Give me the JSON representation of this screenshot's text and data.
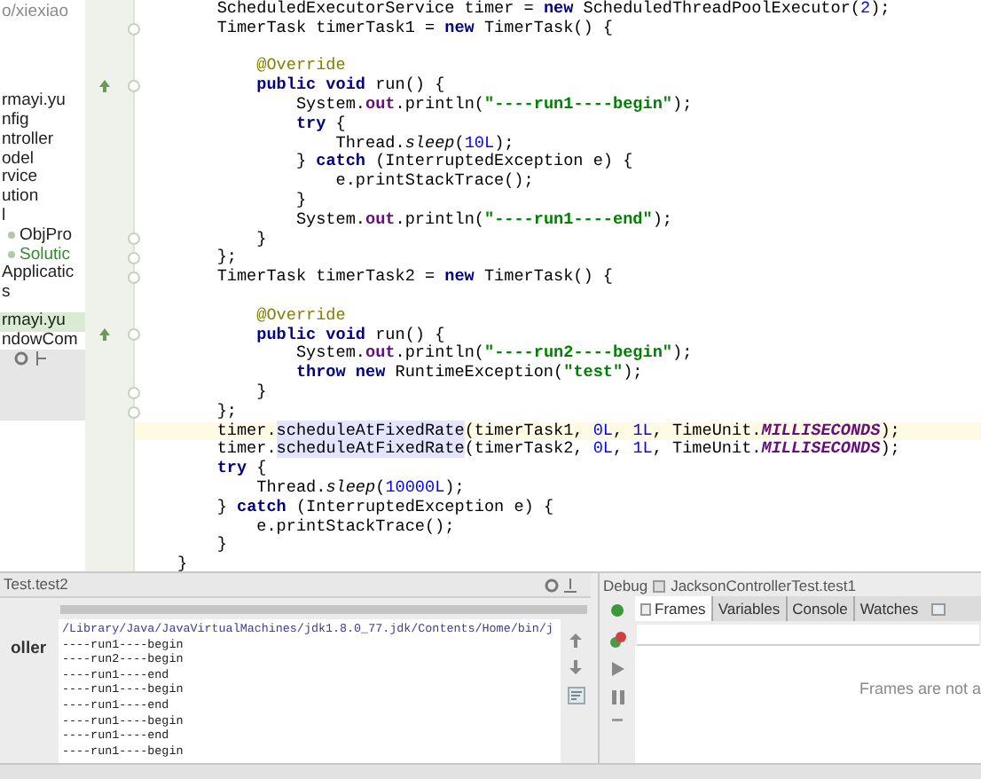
{
  "project_panel": {
    "path": "o/xiexiao",
    "items": [
      {
        "label": "rmayi.yu",
        "kind": "plain",
        "color": "#1f1f1f",
        "selected": false
      },
      {
        "label": "nfig",
        "kind": "plain",
        "color": "#1f1f1f",
        "selected": false
      },
      {
        "label": "ntroller",
        "kind": "plain",
        "color": "#1f1f1f",
        "selected": false
      },
      {
        "label": "odel",
        "kind": "plain",
        "color": "#1f1f1f",
        "selected": false
      },
      {
        "label": "rvice",
        "kind": "plain",
        "color": "#1f1f1f",
        "selected": false
      },
      {
        "label": "ution",
        "kind": "plain",
        "color": "#1f1f1f",
        "selected": false
      },
      {
        "label": "l",
        "kind": "plain",
        "color": "#1f1f1f",
        "selected": false
      },
      {
        "label": "ObjPro",
        "kind": "class",
        "color": "#1f1f1f",
        "selected": false
      },
      {
        "label": "Solutic",
        "kind": "class",
        "color": "#2e8b2e",
        "selected": false
      },
      {
        "label": "Applicatic",
        "kind": "plain",
        "color": "#1f1f1f",
        "selected": false
      },
      {
        "label": "s",
        "kind": "plain",
        "color": "#1f1f1f",
        "selected": false
      },
      {
        "label": "rmayi.yu",
        "kind": "plain",
        "color": "#1f1f1f",
        "selected": true
      },
      {
        "label": "ndowCom",
        "kind": "plain",
        "color": "#1f1f1f",
        "selected": false
      }
    ]
  },
  "editor": {
    "lines": [
      {
        "kind": "code",
        "fold": false,
        "override": false,
        "current": false,
        "tokens": [
          {
            "kind": "plain",
            "text": "    ScheduledExecutorService timer = "
          },
          {
            "kind": "keyword",
            "text": "new"
          },
          {
            "kind": "plain",
            "text": " ScheduledThreadPoolExecutor("
          },
          {
            "kind": "number",
            "text": "2"
          },
          {
            "kind": "plain",
            "text": ");"
          }
        ]
      },
      {
        "kind": "code",
        "fold": true,
        "override": false,
        "current": false,
        "tokens": [
          {
            "kind": "plain",
            "text": "    TimerTask timerTask1 = "
          },
          {
            "kind": "keyword",
            "text": "new"
          },
          {
            "kind": "plain",
            "text": " TimerTask() {"
          }
        ]
      },
      {
        "kind": "blank"
      },
      {
        "kind": "code",
        "fold": false,
        "override": false,
        "current": false,
        "tokens": [
          {
            "kind": "annotation",
            "text": "        @Override"
          }
        ]
      },
      {
        "kind": "code",
        "fold": true,
        "override": true,
        "current": false,
        "tokens": [
          {
            "kind": "keyword",
            "text": "        public void"
          },
          {
            "kind": "plain",
            "text": " run() {"
          }
        ]
      },
      {
        "kind": "code",
        "fold": false,
        "override": false,
        "current": false,
        "tokens": [
          {
            "kind": "plain",
            "text": "            System."
          },
          {
            "kind": "field",
            "text": "out"
          },
          {
            "kind": "plain",
            "text": ".println("
          },
          {
            "kind": "string",
            "text": "\"----run1----begin\""
          },
          {
            "kind": "plain",
            "text": ");"
          }
        ]
      },
      {
        "kind": "code",
        "fold": false,
        "override": false,
        "current": false,
        "tokens": [
          {
            "kind": "keyword",
            "text": "            try"
          },
          {
            "kind": "plain",
            "text": " {"
          }
        ]
      },
      {
        "kind": "code",
        "fold": false,
        "override": false,
        "current": false,
        "tokens": [
          {
            "kind": "plain",
            "text": "                Thread."
          },
          {
            "kind": "static",
            "text": "sleep"
          },
          {
            "kind": "plain",
            "text": "("
          },
          {
            "kind": "number",
            "text": "10L"
          },
          {
            "kind": "plain",
            "text": ");"
          }
        ]
      },
      {
        "kind": "code",
        "fold": false,
        "override": false,
        "current": false,
        "tokens": [
          {
            "kind": "plain",
            "text": "            } "
          },
          {
            "kind": "keyword",
            "text": "catch"
          },
          {
            "kind": "plain",
            "text": " (InterruptedException e) {"
          }
        ]
      },
      {
        "kind": "code",
        "fold": false,
        "override": false,
        "current": false,
        "tokens": [
          {
            "kind": "plain",
            "text": "                e.printStackTrace();"
          }
        ]
      },
      {
        "kind": "code",
        "fold": false,
        "override": false,
        "current": false,
        "tokens": [
          {
            "kind": "plain",
            "text": "            }"
          }
        ]
      },
      {
        "kind": "code",
        "fold": false,
        "override": false,
        "current": false,
        "tokens": [
          {
            "kind": "plain",
            "text": "            System."
          },
          {
            "kind": "field",
            "text": "out"
          },
          {
            "kind": "plain",
            "text": ".println("
          },
          {
            "kind": "string",
            "text": "\"----run1----end\""
          },
          {
            "kind": "plain",
            "text": ");"
          }
        ]
      },
      {
        "kind": "code",
        "fold": true,
        "override": false,
        "current": false,
        "tokens": [
          {
            "kind": "plain",
            "text": "        }"
          }
        ]
      },
      {
        "kind": "code",
        "fold": true,
        "override": false,
        "current": false,
        "tokens": [
          {
            "kind": "plain",
            "text": "    };"
          }
        ]
      },
      {
        "kind": "code",
        "fold": true,
        "override": false,
        "current": false,
        "tokens": [
          {
            "kind": "plain",
            "text": "    TimerTask timerTask2 = "
          },
          {
            "kind": "keyword",
            "text": "new"
          },
          {
            "kind": "plain",
            "text": " TimerTask() {"
          }
        ]
      },
      {
        "kind": "blank"
      },
      {
        "kind": "code",
        "fold": false,
        "override": false,
        "current": false,
        "tokens": [
          {
            "kind": "annotation",
            "text": "        @Override"
          }
        ]
      },
      {
        "kind": "code",
        "fold": true,
        "override": true,
        "current": false,
        "tokens": [
          {
            "kind": "keyword",
            "text": "        public void"
          },
          {
            "kind": "plain",
            "text": " run() {"
          }
        ]
      },
      {
        "kind": "code",
        "fold": false,
        "override": false,
        "current": false,
        "tokens": [
          {
            "kind": "plain",
            "text": "            System."
          },
          {
            "kind": "field",
            "text": "out"
          },
          {
            "kind": "plain",
            "text": ".println("
          },
          {
            "kind": "string",
            "text": "\"----run2----begin\""
          },
          {
            "kind": "plain",
            "text": ");"
          }
        ]
      },
      {
        "kind": "code",
        "fold": false,
        "override": false,
        "current": false,
        "tokens": [
          {
            "kind": "keyword",
            "text": "            throw new"
          },
          {
            "kind": "plain",
            "text": " RuntimeException("
          },
          {
            "kind": "string",
            "text": "\"test\""
          },
          {
            "kind": "plain",
            "text": ");"
          }
        ]
      },
      {
        "kind": "code",
        "fold": true,
        "override": false,
        "current": false,
        "tokens": [
          {
            "kind": "plain",
            "text": "        }"
          }
        ]
      },
      {
        "kind": "code",
        "fold": true,
        "override": false,
        "current": false,
        "tokens": [
          {
            "kind": "plain",
            "text": "    };"
          }
        ]
      },
      {
        "kind": "code",
        "fold": false,
        "override": false,
        "current": true,
        "tokens": [
          {
            "kind": "plain",
            "text": "    timer."
          },
          {
            "kind": "usage",
            "text": "scheduleAtFixedRate"
          },
          {
            "kind": "plain",
            "text": "(timerTask1, "
          },
          {
            "kind": "number",
            "text": "0L"
          },
          {
            "kind": "plain",
            "text": ", "
          },
          {
            "kind": "number",
            "text": "1L"
          },
          {
            "kind": "plain",
            "text": ", TimeUnit."
          },
          {
            "kind": "constant",
            "text": "MILLISECONDS"
          },
          {
            "kind": "plain",
            "text": ");"
          }
        ]
      },
      {
        "kind": "code",
        "fold": false,
        "override": false,
        "current": false,
        "tokens": [
          {
            "kind": "plain",
            "text": "    timer."
          },
          {
            "kind": "usage",
            "text": "scheduleAtFixedRate"
          },
          {
            "kind": "plain",
            "text": "(timerTask2, "
          },
          {
            "kind": "number",
            "text": "0L"
          },
          {
            "kind": "plain",
            "text": ", "
          },
          {
            "kind": "number",
            "text": "1L"
          },
          {
            "kind": "plain",
            "text": ", TimeUnit."
          },
          {
            "kind": "constant",
            "text": "MILLISECONDS"
          },
          {
            "kind": "plain",
            "text": ");"
          }
        ]
      },
      {
        "kind": "code",
        "fold": false,
        "override": false,
        "current": false,
        "tokens": [
          {
            "kind": "keyword",
            "text": "    try"
          },
          {
            "kind": "plain",
            "text": " {"
          }
        ]
      },
      {
        "kind": "code",
        "fold": false,
        "override": false,
        "current": false,
        "tokens": [
          {
            "kind": "plain",
            "text": "        Thread."
          },
          {
            "kind": "static",
            "text": "sleep"
          },
          {
            "kind": "plain",
            "text": "("
          },
          {
            "kind": "number",
            "text": "10000L"
          },
          {
            "kind": "plain",
            "text": ");"
          }
        ]
      },
      {
        "kind": "code",
        "fold": false,
        "override": false,
        "current": false,
        "tokens": [
          {
            "kind": "plain",
            "text": "    } "
          },
          {
            "kind": "keyword",
            "text": "catch"
          },
          {
            "kind": "plain",
            "text": " (InterruptedException e) {"
          }
        ]
      },
      {
        "kind": "code",
        "fold": false,
        "override": false,
        "current": false,
        "tokens": [
          {
            "kind": "plain",
            "text": "        e.printStackTrace();"
          }
        ]
      },
      {
        "kind": "code",
        "fold": false,
        "override": false,
        "current": false,
        "tokens": [
          {
            "kind": "plain",
            "text": "    }"
          }
        ]
      },
      {
        "kind": "code",
        "fold": false,
        "override": false,
        "current": false,
        "tokens": [
          {
            "kind": "plain",
            "text": "}"
          }
        ]
      }
    ]
  },
  "run_panel": {
    "title": "Test.test2",
    "progress": {
      "level": 1
    },
    "tab": "oller",
    "console": [
      {
        "kind": "command",
        "text": "/Library/Java/JavaVirtualMachines/jdk1.8.0_77.jdk/Contents/Home/bin/j"
      },
      {
        "kind": "output",
        "text": "----run1----begin"
      },
      {
        "kind": "output",
        "text": "----run2----begin"
      },
      {
        "kind": "output",
        "text": "----run1----end"
      },
      {
        "kind": "output",
        "text": "----run1----begin"
      },
      {
        "kind": "output",
        "text": "----run1----end"
      },
      {
        "kind": "output",
        "text": "----run1----begin"
      },
      {
        "kind": "output",
        "text": "----run1----end"
      },
      {
        "kind": "output",
        "text": "----run1----begin"
      }
    ]
  },
  "debug_panel": {
    "title": "Debug",
    "config": "JacksonControllerTest.test1",
    "tabs": [
      {
        "label": "Frames",
        "selected": true
      },
      {
        "label": "Variables",
        "selected": false
      },
      {
        "label": "Console",
        "selected": false
      },
      {
        "label": "Watches",
        "selected": false
      }
    ],
    "message": "Frames are not a"
  }
}
